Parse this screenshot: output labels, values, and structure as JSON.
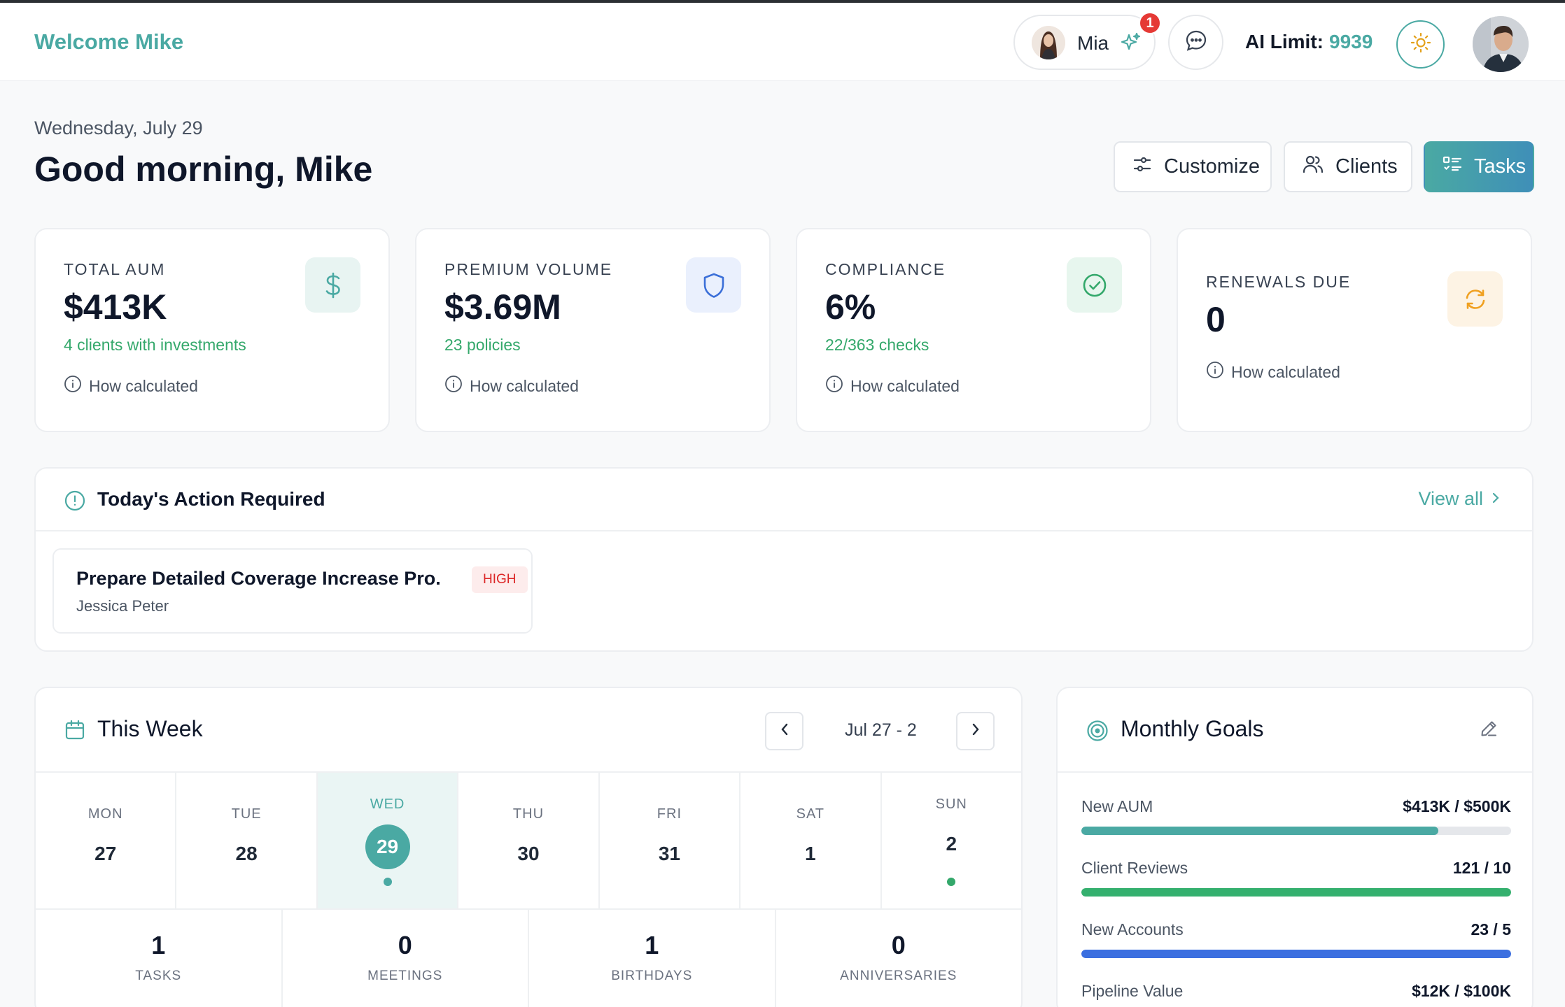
{
  "header": {
    "welcome": "Welcome Mike",
    "assistant_name": "Mia",
    "notification_count": "1",
    "ai_limit_label": "AI Limit:",
    "ai_limit_value": "9939"
  },
  "greeting": {
    "date": "Wednesday, July 29",
    "title": "Good morning, Mike"
  },
  "actions": {
    "customize": "Customize",
    "clients": "Clients",
    "tasks": "Tasks"
  },
  "stats": [
    {
      "label": "TOTAL AUM",
      "value": "$413K",
      "sub": "4 clients with investments",
      "how": "How calculated",
      "icon": "dollar-icon",
      "icon_bg": "#e8f4f2",
      "icon_color": "#4aa9a3"
    },
    {
      "label": "PREMIUM VOLUME",
      "value": "$3.69M",
      "sub": "23 policies",
      "how": "How calculated",
      "icon": "shield-icon",
      "icon_bg": "#eaf0fd",
      "icon_color": "#3b6fd8"
    },
    {
      "label": "COMPLIANCE",
      "value": "6%",
      "sub": "22/363 checks",
      "how": "How calculated",
      "icon": "check-circle-icon",
      "icon_bg": "#e7f6ee",
      "icon_color": "#34a86b"
    },
    {
      "label": "RENEWALS DUE",
      "value": "0",
      "sub": "",
      "how": "How calculated",
      "icon": "refresh-icon",
      "icon_bg": "#fdf3e4",
      "icon_color": "#f0a020"
    }
  ],
  "action_required": {
    "title": "Today's Action Required",
    "view_all": "View all",
    "tasks": [
      {
        "title": "Prepare Detailed Coverage Increase Pro...",
        "client": "Jessica Peter",
        "priority": "HIGH"
      }
    ]
  },
  "this_week": {
    "title": "This Week",
    "range": "Jul 27 - 2",
    "days": [
      {
        "name": "MON",
        "num": "27"
      },
      {
        "name": "TUE",
        "num": "28"
      },
      {
        "name": "WED",
        "num": "29",
        "today": true
      },
      {
        "name": "THU",
        "num": "30"
      },
      {
        "name": "FRI",
        "num": "31"
      },
      {
        "name": "SAT",
        "num": "1"
      },
      {
        "name": "SUN",
        "num": "2"
      }
    ],
    "counts": [
      {
        "num": "1",
        "label": "TASKS"
      },
      {
        "num": "0",
        "label": "MEETINGS"
      },
      {
        "num": "1",
        "label": "BIRTHDAYS"
      },
      {
        "num": "0",
        "label": "ANNIVERSARIES"
      }
    ]
  },
  "monthly_goals": {
    "title": "Monthly Goals",
    "goals": [
      {
        "label": "New AUM",
        "value": "$413K / $500K",
        "progress": 0.83,
        "color": "#4aa9a3"
      },
      {
        "label": "Client Reviews",
        "value": "121 / 10",
        "progress": 1.0,
        "color": "#34b06e"
      },
      {
        "label": "New Accounts",
        "value": "23 / 5",
        "progress": 1.0,
        "color": "#3b6fe0"
      },
      {
        "label": "Pipeline Value",
        "value": "$12K / $100K",
        "progress": 0.12,
        "color": "#4aa9a3"
      }
    ]
  }
}
